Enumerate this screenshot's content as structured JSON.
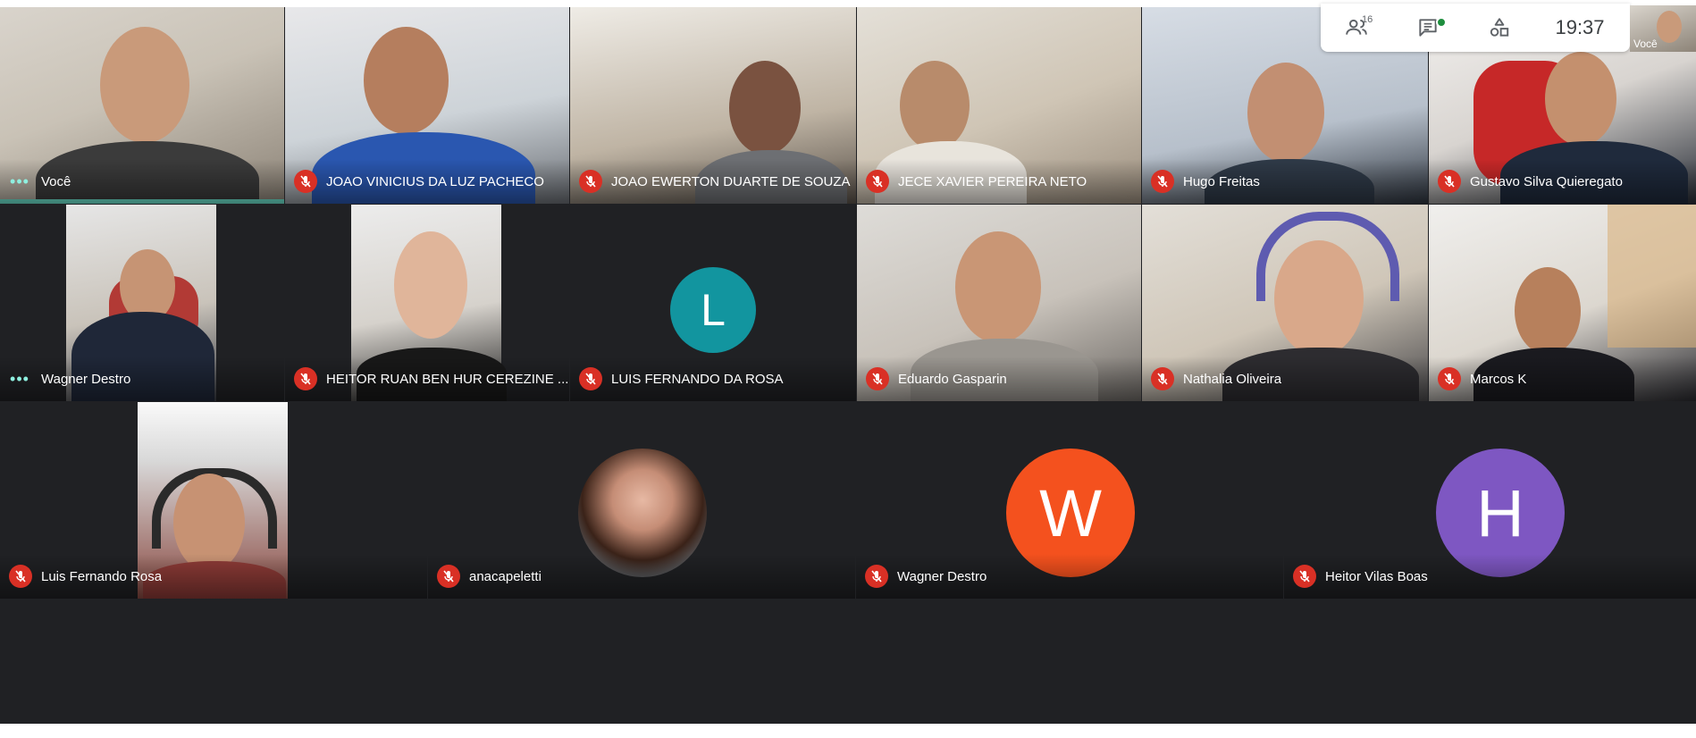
{
  "topbar": {
    "participants_count": "16",
    "time": "19:37",
    "self_label": "Você",
    "icons": [
      "people-icon",
      "chat-icon",
      "activities-icon"
    ]
  },
  "tiles": {
    "voce": {
      "name": "Você"
    },
    "joao_vinicius": {
      "name": "JOAO VINICIUS DA LUZ PACHECO"
    },
    "joao_ewerton": {
      "name": "JOAO EWERTON DUARTE DE SOUZA"
    },
    "jece": {
      "name": "JECE XAVIER PEREIRA NETO"
    },
    "hugo": {
      "name": "Hugo Freitas"
    },
    "gustavo": {
      "name": "Gustavo Silva Quieregato"
    },
    "wagner_cam": {
      "name": "Wagner Destro"
    },
    "heitor_ruan": {
      "name": "HEITOR RUAN BEN HUR CEREZINE ..."
    },
    "luis_fernando_da_rosa": {
      "name": "LUIS FERNANDO DA ROSA",
      "initial": "L",
      "color": "#12959f"
    },
    "eduardo": {
      "name": "Eduardo Gasparin"
    },
    "nathalia": {
      "name": "Nathalia Oliveira"
    },
    "marcos": {
      "name": "Marcos K"
    },
    "luis_fernando_rosa": {
      "name": "Luis Fernando Rosa"
    },
    "anacapeletti": {
      "name": "anacapeletti"
    },
    "wagner_avatar": {
      "name": "Wagner Destro",
      "initial": "W",
      "color": "#f4511e"
    },
    "heitor_vilas": {
      "name": "Heitor Vilas Boas",
      "initial": "H",
      "color": "#7e57c2"
    }
  },
  "colors": {
    "grid_background": "#202124",
    "muted_mic": "#d93025",
    "speaking_indicator": "#6fe8d2"
  }
}
